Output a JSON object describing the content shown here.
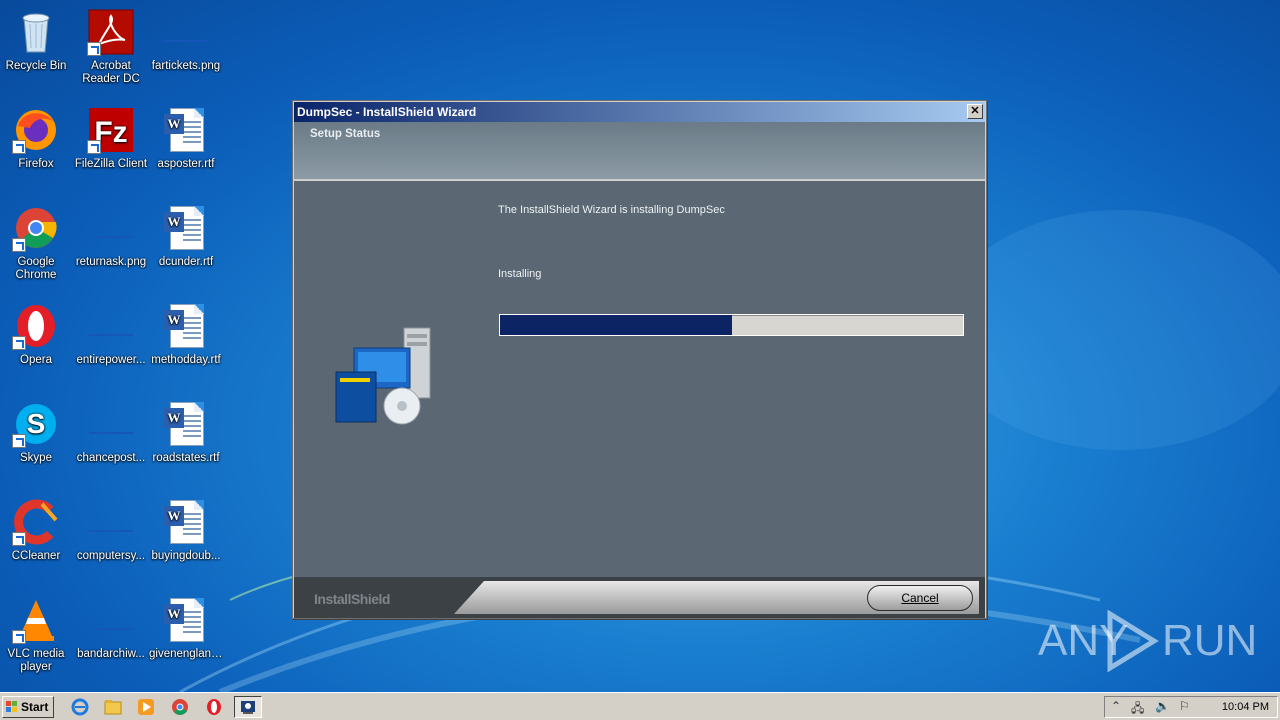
{
  "desktop": {
    "icons": [
      {
        "label": "Recycle Bin"
      },
      {
        "label": "Acrobat Reader DC"
      },
      {
        "label": "fartickets.png"
      },
      {
        "label": "Firefox"
      },
      {
        "label": "FileZilla Client"
      },
      {
        "label": "asposter.rtf"
      },
      {
        "label": "Google Chrome"
      },
      {
        "label": "returnask.png"
      },
      {
        "label": "dcunder.rtf"
      },
      {
        "label": "Opera"
      },
      {
        "label": "entirepower..."
      },
      {
        "label": "methodday.rtf"
      },
      {
        "label": "Skype"
      },
      {
        "label": "chancepost..."
      },
      {
        "label": "roadstates.rtf"
      },
      {
        "label": "CCleaner"
      },
      {
        "label": "computersy..."
      },
      {
        "label": "buyingdoub..."
      },
      {
        "label": "VLC media player"
      },
      {
        "label": "bandarchiw..."
      },
      {
        "label": "givenengland..."
      }
    ]
  },
  "dialog": {
    "title": "DumpSec - InstallShield Wizard",
    "close_glyph": "✕",
    "header_title": "Setup Status",
    "status_message": "The InstallShield Wizard is installing DumpSec",
    "status_action": "Installing",
    "progress_fraction": 0.5,
    "footer_brand": "InstallShield",
    "cancel_label": "Cancel"
  },
  "watermark": {
    "left": "ANY",
    "right": "RUN"
  },
  "taskbar": {
    "start_label": "Start",
    "clock": "10:04 PM",
    "tray_icons": [
      "chevron-up-icon",
      "network-icon",
      "speaker-icon",
      "flag-icon"
    ]
  },
  "colors": {
    "title_gradient_start": "#0a246a",
    "title_gradient_end": "#a6caf0",
    "progress_fill": "#0c2463",
    "dialog_body": "#5b6873"
  }
}
